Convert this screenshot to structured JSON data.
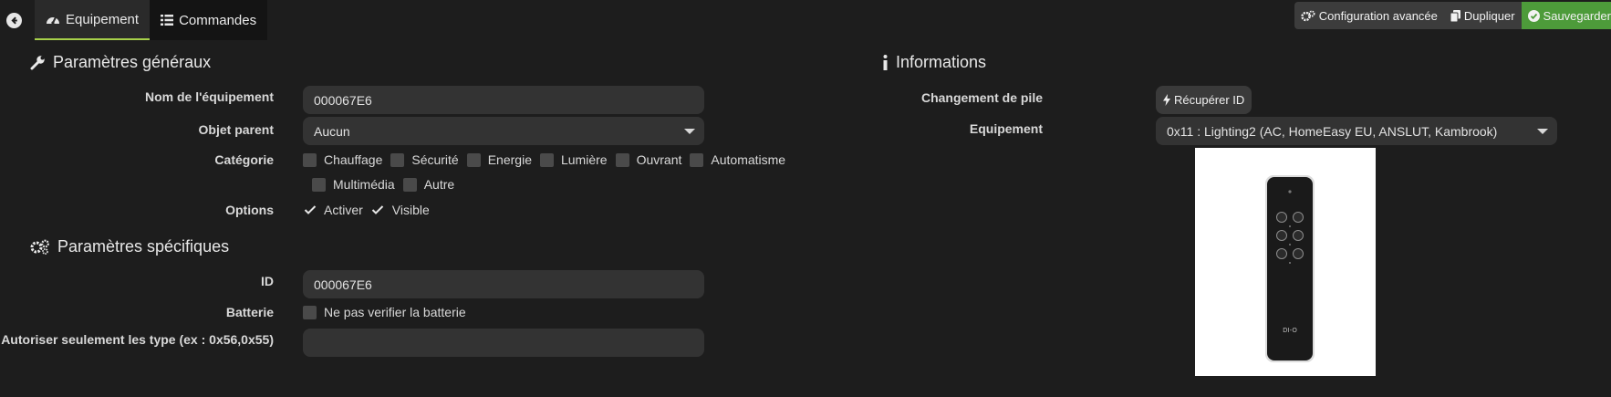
{
  "tabs": {
    "equipement_label": "Equipement",
    "commandes_label": "Commandes"
  },
  "actions": {
    "config_label": "Configuration avancée",
    "duplicate_label": "Dupliquer",
    "save_label": "Sauvegarder"
  },
  "general": {
    "title": "Paramètres généraux",
    "name_label": "Nom de l'équipement",
    "name_value": "000067E6",
    "parent_label": "Objet parent",
    "parent_value": "Aucun",
    "category_label": "Catégorie",
    "categories": [
      "Chauffage",
      "Sécurité",
      "Energie",
      "Lumière",
      "Ouvrant",
      "Automatisme",
      "Multimédia",
      "Autre"
    ],
    "options_label": "Options",
    "option_activer": "Activer",
    "option_visible": "Visible"
  },
  "specific": {
    "title": "Paramètres spécifiques",
    "id_label": "ID",
    "id_value": "000067E6",
    "battery_label": "Batterie",
    "battery_option": "Ne pas verifier la batterie",
    "types_label": "Autoriser seulement les type (ex : 0x56,0x55)",
    "types_value": ""
  },
  "info": {
    "title": "Informations",
    "battery_change_label": "Changement de pile",
    "recover_button": "Récupérer ID",
    "equipment_label": "Equipement",
    "equipment_value": "0x11 : Lighting2 (AC, HomeEasy EU, ANSLUT, Kambrook)",
    "remote_brand": "DI-O"
  },
  "colors": {
    "background": "#1d1d1d",
    "active_tab_underline": "#a7d14a",
    "save_green": "#4d9b3a"
  }
}
